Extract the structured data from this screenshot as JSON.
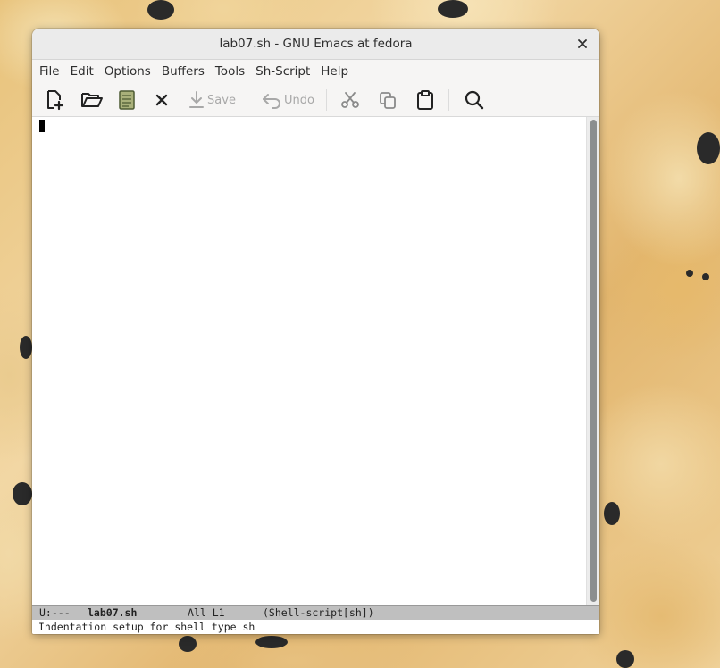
{
  "window": {
    "title": "lab07.sh - GNU Emacs at fedora",
    "close_glyph": "×"
  },
  "menubar": {
    "items": [
      "File",
      "Edit",
      "Options",
      "Buffers",
      "Tools",
      "Sh-Script",
      "Help"
    ]
  },
  "toolbar": {
    "new_icon": "new-file-icon",
    "open_icon": "open-folder-icon",
    "dired_icon": "notebook-icon",
    "close_icon": "close-buffer-icon",
    "save_label": "Save",
    "undo_label": "Undo",
    "cut_icon": "scissors-icon",
    "copy_icon": "copy-icon",
    "paste_icon": "clipboard-icon",
    "search_icon": "search-icon"
  },
  "modeline": {
    "status": "U:---",
    "buffer_name": "lab07.sh",
    "position": "All L1",
    "mode": "(Shell-script[sh])"
  },
  "echo_area": {
    "message": "Indentation setup for shell type sh"
  },
  "colors": {
    "title_bar": "#ebebeb",
    "menu_bg": "#f6f5f4",
    "editor_bg": "#ffffff",
    "modeline_bg": "#bfbfbf",
    "disabled_text": "#a8a8a8"
  }
}
